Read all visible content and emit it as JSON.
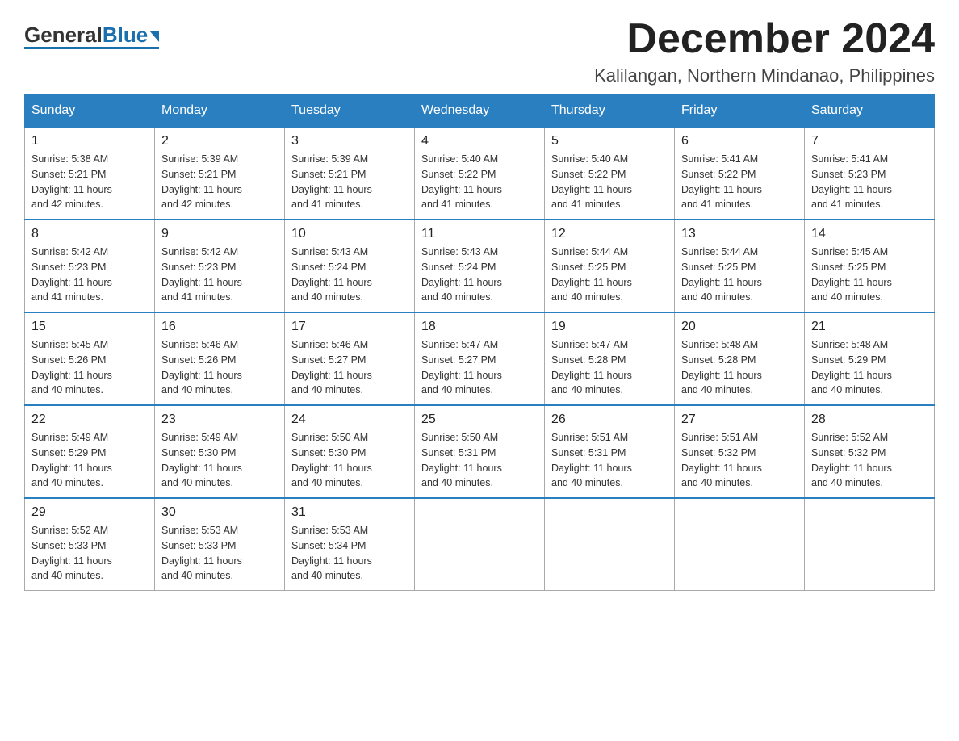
{
  "header": {
    "logo_general": "General",
    "logo_blue": "Blue",
    "month_title": "December 2024",
    "location": "Kalilangan, Northern Mindanao, Philippines"
  },
  "weekdays": [
    "Sunday",
    "Monday",
    "Tuesday",
    "Wednesday",
    "Thursday",
    "Friday",
    "Saturday"
  ],
  "weeks": [
    [
      {
        "day": "1",
        "sunrise": "5:38 AM",
        "sunset": "5:21 PM",
        "daylight": "11 hours and 42 minutes."
      },
      {
        "day": "2",
        "sunrise": "5:39 AM",
        "sunset": "5:21 PM",
        "daylight": "11 hours and 42 minutes."
      },
      {
        "day": "3",
        "sunrise": "5:39 AM",
        "sunset": "5:21 PM",
        "daylight": "11 hours and 41 minutes."
      },
      {
        "day": "4",
        "sunrise": "5:40 AM",
        "sunset": "5:22 PM",
        "daylight": "11 hours and 41 minutes."
      },
      {
        "day": "5",
        "sunrise": "5:40 AM",
        "sunset": "5:22 PM",
        "daylight": "11 hours and 41 minutes."
      },
      {
        "day": "6",
        "sunrise": "5:41 AM",
        "sunset": "5:22 PM",
        "daylight": "11 hours and 41 minutes."
      },
      {
        "day": "7",
        "sunrise": "5:41 AM",
        "sunset": "5:23 PM",
        "daylight": "11 hours and 41 minutes."
      }
    ],
    [
      {
        "day": "8",
        "sunrise": "5:42 AM",
        "sunset": "5:23 PM",
        "daylight": "11 hours and 41 minutes."
      },
      {
        "day": "9",
        "sunrise": "5:42 AM",
        "sunset": "5:23 PM",
        "daylight": "11 hours and 41 minutes."
      },
      {
        "day": "10",
        "sunrise": "5:43 AM",
        "sunset": "5:24 PM",
        "daylight": "11 hours and 40 minutes."
      },
      {
        "day": "11",
        "sunrise": "5:43 AM",
        "sunset": "5:24 PM",
        "daylight": "11 hours and 40 minutes."
      },
      {
        "day": "12",
        "sunrise": "5:44 AM",
        "sunset": "5:25 PM",
        "daylight": "11 hours and 40 minutes."
      },
      {
        "day": "13",
        "sunrise": "5:44 AM",
        "sunset": "5:25 PM",
        "daylight": "11 hours and 40 minutes."
      },
      {
        "day": "14",
        "sunrise": "5:45 AM",
        "sunset": "5:25 PM",
        "daylight": "11 hours and 40 minutes."
      }
    ],
    [
      {
        "day": "15",
        "sunrise": "5:45 AM",
        "sunset": "5:26 PM",
        "daylight": "11 hours and 40 minutes."
      },
      {
        "day": "16",
        "sunrise": "5:46 AM",
        "sunset": "5:26 PM",
        "daylight": "11 hours and 40 minutes."
      },
      {
        "day": "17",
        "sunrise": "5:46 AM",
        "sunset": "5:27 PM",
        "daylight": "11 hours and 40 minutes."
      },
      {
        "day": "18",
        "sunrise": "5:47 AM",
        "sunset": "5:27 PM",
        "daylight": "11 hours and 40 minutes."
      },
      {
        "day": "19",
        "sunrise": "5:47 AM",
        "sunset": "5:28 PM",
        "daylight": "11 hours and 40 minutes."
      },
      {
        "day": "20",
        "sunrise": "5:48 AM",
        "sunset": "5:28 PM",
        "daylight": "11 hours and 40 minutes."
      },
      {
        "day": "21",
        "sunrise": "5:48 AM",
        "sunset": "5:29 PM",
        "daylight": "11 hours and 40 minutes."
      }
    ],
    [
      {
        "day": "22",
        "sunrise": "5:49 AM",
        "sunset": "5:29 PM",
        "daylight": "11 hours and 40 minutes."
      },
      {
        "day": "23",
        "sunrise": "5:49 AM",
        "sunset": "5:30 PM",
        "daylight": "11 hours and 40 minutes."
      },
      {
        "day": "24",
        "sunrise": "5:50 AM",
        "sunset": "5:30 PM",
        "daylight": "11 hours and 40 minutes."
      },
      {
        "day": "25",
        "sunrise": "5:50 AM",
        "sunset": "5:31 PM",
        "daylight": "11 hours and 40 minutes."
      },
      {
        "day": "26",
        "sunrise": "5:51 AM",
        "sunset": "5:31 PM",
        "daylight": "11 hours and 40 minutes."
      },
      {
        "day": "27",
        "sunrise": "5:51 AM",
        "sunset": "5:32 PM",
        "daylight": "11 hours and 40 minutes."
      },
      {
        "day": "28",
        "sunrise": "5:52 AM",
        "sunset": "5:32 PM",
        "daylight": "11 hours and 40 minutes."
      }
    ],
    [
      {
        "day": "29",
        "sunrise": "5:52 AM",
        "sunset": "5:33 PM",
        "daylight": "11 hours and 40 minutes."
      },
      {
        "day": "30",
        "sunrise": "5:53 AM",
        "sunset": "5:33 PM",
        "daylight": "11 hours and 40 minutes."
      },
      {
        "day": "31",
        "sunrise": "5:53 AM",
        "sunset": "5:34 PM",
        "daylight": "11 hours and 40 minutes."
      },
      null,
      null,
      null,
      null
    ]
  ],
  "labels": {
    "sunrise": "Sunrise:",
    "sunset": "Sunset:",
    "daylight": "Daylight:"
  }
}
